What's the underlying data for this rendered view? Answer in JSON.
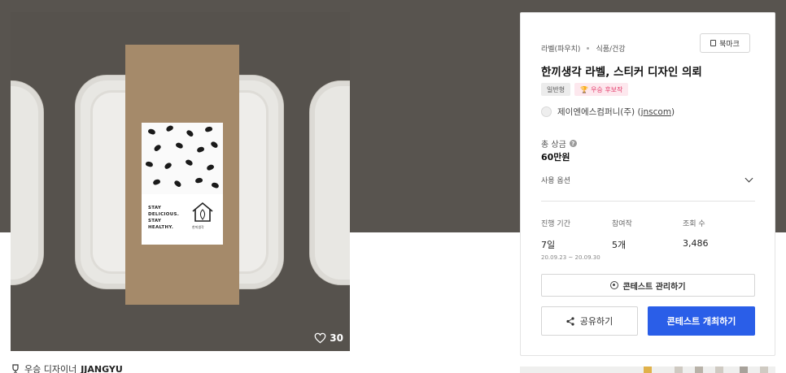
{
  "hero": {
    "image_alt": "Product packaging mockup",
    "label_text_lines": [
      "STAY",
      "DELICIOUS.",
      "STAY",
      "HEALTHY."
    ],
    "label_brand": "한끼생각",
    "likes_count": "30"
  },
  "designer": {
    "prefix": "우승 디자이너",
    "name": "JJANGYU_"
  },
  "card": {
    "breadcrumb": [
      "라벨(파우치)",
      "식품/건강"
    ],
    "bookmark_label": "북마크",
    "title": "한끼생각 라벨, 스티커 디자인 의뢰",
    "badges": {
      "type": "일반형",
      "winner": "우승 후보작"
    },
    "company": {
      "name": "제이엔에스컴퍼니(주)",
      "handle": "jnscom"
    },
    "prize": {
      "label": "총 상금",
      "value": "60만원"
    },
    "options_label": "사용 옵션",
    "stats": {
      "period": {
        "label": "진행 기간",
        "value": "7일",
        "range": "20.09.23 ~ 20.09.30"
      },
      "entries": {
        "label": "참여작",
        "value": "5개"
      },
      "views": {
        "label": "조회 수",
        "value": "3,486"
      }
    },
    "manage_label": "콘테스트 관리하기",
    "share_label": "공유하기",
    "host_label": "콘테스트 개최하기"
  },
  "colors": {
    "top_band": "#58544f",
    "primary_button": "#2a5ee8",
    "winner_badge_text": "#e33b6a"
  }
}
